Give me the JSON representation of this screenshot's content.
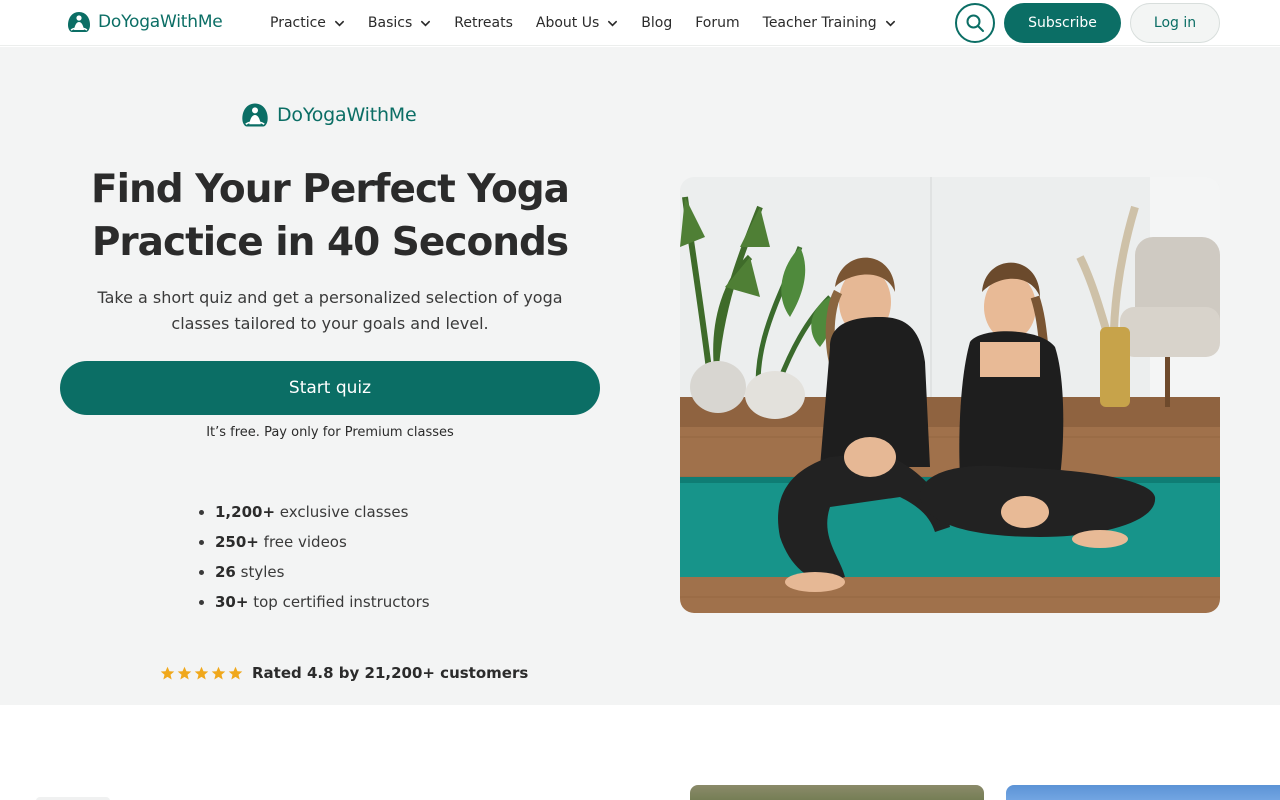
{
  "brand": {
    "name": "DoYogaWithMe"
  },
  "nav": {
    "items": [
      {
        "label": "Practice",
        "dropdown": true
      },
      {
        "label": "Basics",
        "dropdown": true
      },
      {
        "label": "Retreats",
        "dropdown": false
      },
      {
        "label": "About Us",
        "dropdown": true
      },
      {
        "label": "Blog",
        "dropdown": false
      },
      {
        "label": "Forum",
        "dropdown": false
      },
      {
        "label": "Teacher Training",
        "dropdown": true
      }
    ],
    "search_icon": "search-icon",
    "subscribe_label": "Subscribe",
    "login_label": "Log in"
  },
  "hero": {
    "title_line1": "Find Your Perfect Yoga",
    "title_line2": "Practice in 40 Seconds",
    "subtitle": "Take a short quiz and get a personalized selection of yoga classes tailored to your goals and level.",
    "cta_label": "Start quiz",
    "cta_note": "It’s free. Pay only for Premium classes",
    "features": [
      {
        "bold": "1,200+",
        "text": " exclusive classes"
      },
      {
        "bold": "250+",
        "text": " free videos"
      },
      {
        "bold": "26",
        "text": " styles"
      },
      {
        "bold": "30+",
        "text": " top certified instructors"
      }
    ],
    "rating": {
      "stars": 5,
      "text": "Rated 4.8 by 21,200+ customers"
    }
  },
  "colors": {
    "brand": "#0b6e65",
    "hero_bg": "#f3f4f4",
    "star": "#f0a81b",
    "mat": "#17948a"
  }
}
